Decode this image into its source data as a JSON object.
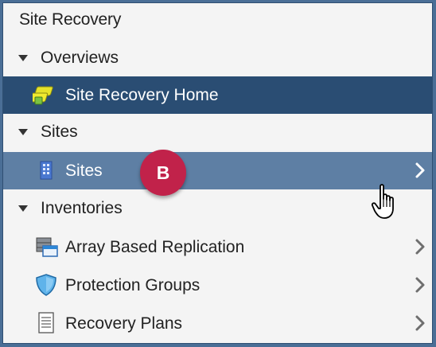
{
  "panel": {
    "title": "Site Recovery"
  },
  "sections": [
    {
      "label": "Overviews"
    },
    {
      "label": "Sites"
    },
    {
      "label": "Inventories"
    }
  ],
  "items": {
    "home": {
      "label": "Site Recovery Home",
      "icon": "site-recovery-icon"
    },
    "sites": {
      "label": "Sites",
      "icon": "building-icon"
    },
    "array": {
      "label": "Array Based Replication",
      "icon": "storage-array-icon"
    },
    "protection": {
      "label": "Protection Groups",
      "icon": "shield-icon"
    },
    "plans": {
      "label": "Recovery Plans",
      "icon": "document-list-icon"
    }
  },
  "callout": {
    "label": "B"
  },
  "colors": {
    "selected": "#2a4d73",
    "hover": "#5e7fa4",
    "badge": "#c1224a"
  }
}
